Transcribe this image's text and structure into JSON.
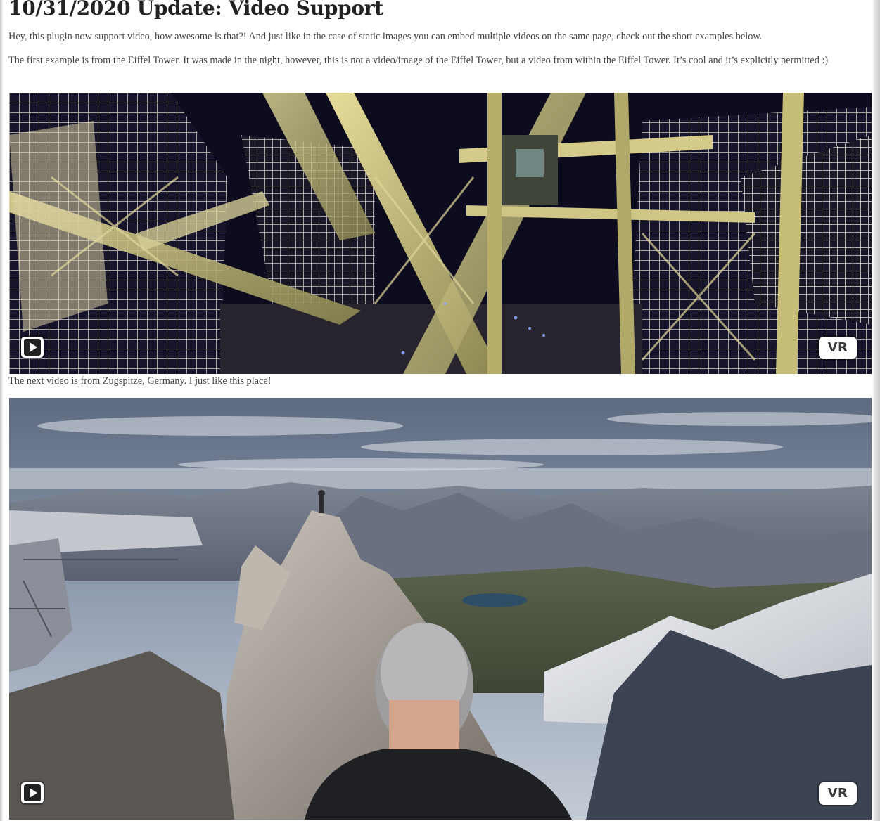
{
  "post": {
    "title": "10/31/2020 Update: Video Support",
    "intro": "Hey, this plugin now support video, how awesome is that?! And just like in the case of static images you can embed multiple videos on the same page, check out the short examples below.",
    "eiffel_text": "The first example is from the Eiffel Tower. It was made in the night, however, this is not a video/image of the Eiffel Tower, but a video from within the Eiffel Tower. It’s cool and it’s explicitly permitted :)",
    "zugspitze_text": "The next video is from Zugspitze, Germany. I just like this place!"
  },
  "videos": [
    {
      "player": "panorama-video-player",
      "play_icon": "play-icon",
      "vr_label": "VR"
    },
    {
      "player": "panorama-video-player",
      "play_icon": "play-icon",
      "vr_label": "VR"
    }
  ],
  "colors": {
    "tower_steel": "#c8c27a",
    "night_sky": "#0d0c1e",
    "mountain_sky": "#8f9bae",
    "rock": "#9b948c",
    "snow": "#e8e8ea"
  }
}
